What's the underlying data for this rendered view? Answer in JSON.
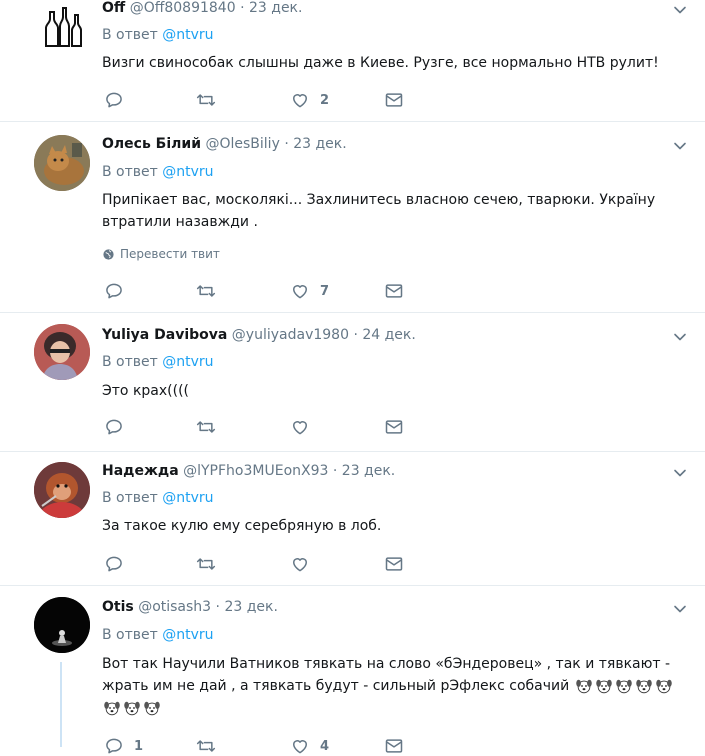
{
  "tweets": [
    {
      "name": "Off",
      "handle": "@Off80891840",
      "date": "23 дек.",
      "reply_prefix": "В ответ",
      "reply_to": "@ntvru",
      "text": "Визги свинособак слышны даже в Киеве. Рузге, все нормально НТВ рулит!",
      "likes": "2",
      "replies": "",
      "retweets": "",
      "avatar_icon": "bottles-avatar"
    },
    {
      "name": "Олесь Білий",
      "handle": "@OlesBiliy",
      "date": "23 дек.",
      "reply_prefix": "В ответ",
      "reply_to": "@ntvru",
      "text": "Припікает вас, москолякі... Захлинитесь власною сечею, тварюки. Україну втратили назавжди .",
      "translate": "Перевести твит",
      "likes": "7",
      "replies": "",
      "retweets": "",
      "avatar_icon": "cat-avatar"
    },
    {
      "name": "Yuliya Davibova",
      "handle": "@yuliyadav1980",
      "date": "24 дек.",
      "reply_prefix": "В ответ",
      "reply_to": "@ntvru",
      "text": "Это крах((((",
      "likes": "",
      "replies": "",
      "retweets": "",
      "avatar_icon": "woman-avatar"
    },
    {
      "name": "Надежда",
      "handle": "@lYPFho3MUEonX93",
      "date": "23 дек.",
      "reply_prefix": "В ответ",
      "reply_to": "@ntvru",
      "text": "За такое кулю ему серебряную в лоб.",
      "likes": "",
      "replies": "",
      "retweets": "",
      "avatar_icon": "monkey-avatar"
    },
    {
      "name": "Otis",
      "handle": "@otisash3",
      "date": "23 дек.",
      "reply_prefix": "В ответ",
      "reply_to": "@ntvru",
      "text_line1": "Вот так Научили Ватников тявкать на слово «бЭндеровец» , так и тявкают -",
      "text_line2": "жрать им не дай , а тявкать будут - сильный рЭфлекс собачий",
      "emoji": "dog-face-emoji",
      "likes": "4",
      "replies": "1",
      "retweets": "",
      "avatar_icon": "dark-figure-avatar"
    }
  ],
  "colors": {
    "accent": "#1da1f2",
    "muted": "#657786",
    "text": "#14171a",
    "border": "#e6ecf0"
  }
}
